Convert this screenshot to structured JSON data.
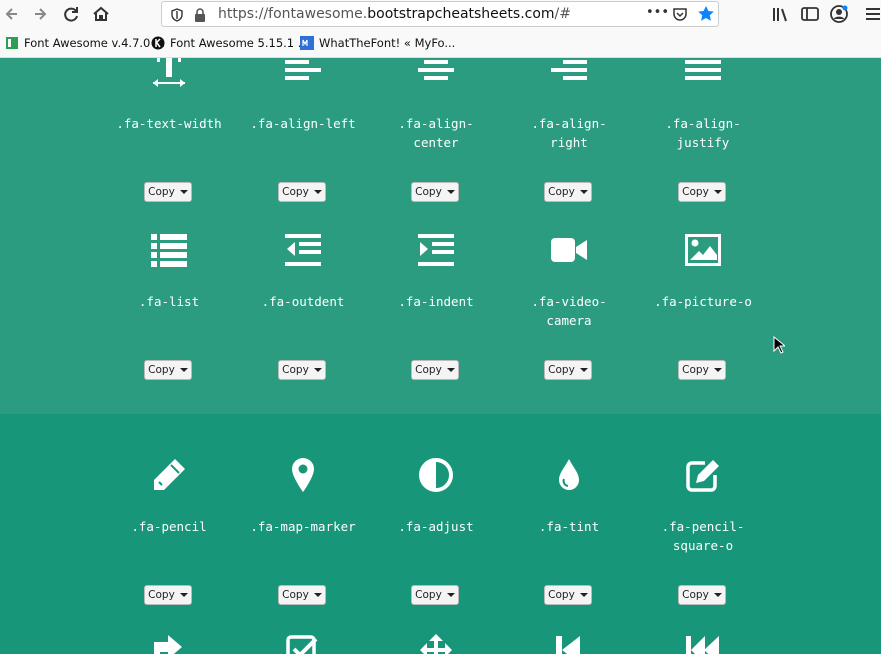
{
  "browser": {
    "url_prefix": "https://fontawesome.",
    "url_domain": "bootstrapcheatsheets.com",
    "url_suffix": "/#",
    "more_label": "•••"
  },
  "bookmarks": [
    {
      "label": "Font Awesome v.4.7.0 ..."
    },
    {
      "label": "Font Awesome 5.15.1 ..."
    },
    {
      "label": "WhatTheFont! « MyFo..."
    }
  ],
  "copy_label": "Copy",
  "icons_row1": [
    {
      "name": ".fa-text-width"
    },
    {
      "name": ".fa-align-left"
    },
    {
      "name": ".fa-align-\ncenter"
    },
    {
      "name": ".fa-align-\nright"
    },
    {
      "name": ".fa-align-\njustify"
    }
  ],
  "icons_row2": [
    {
      "name": ".fa-list"
    },
    {
      "name": ".fa-outdent"
    },
    {
      "name": ".fa-indent"
    },
    {
      "name": ".fa-video-\ncamera"
    },
    {
      "name": ".fa-picture-o"
    }
  ],
  "icons_row3": [
    {
      "name": ".fa-pencil"
    },
    {
      "name": ".fa-map-marker"
    },
    {
      "name": ".fa-adjust"
    },
    {
      "name": ".fa-tint"
    },
    {
      "name": ".fa-pencil-\nsquare-o"
    }
  ],
  "colors": {
    "band_top": "#2c9c80",
    "band_bottom": "#17967a"
  }
}
